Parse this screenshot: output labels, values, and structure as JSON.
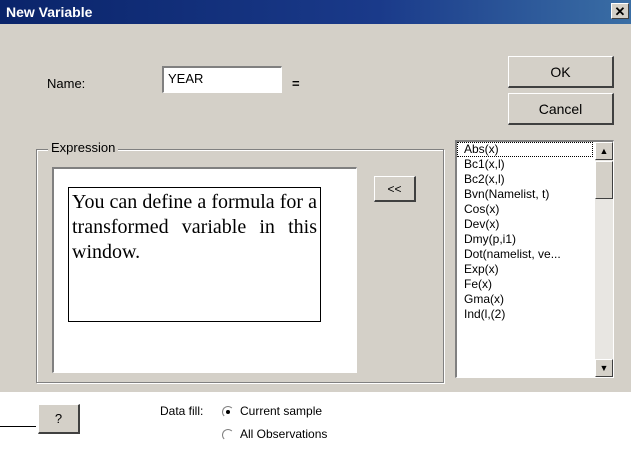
{
  "window": {
    "title": "New Variable",
    "close_glyph": "✕"
  },
  "name_field": {
    "label": "Name:",
    "value": "YEAR",
    "equals": "="
  },
  "buttons": {
    "ok": "OK",
    "cancel": "Cancel",
    "insert": "<<",
    "help": "?"
  },
  "expression": {
    "group_label": "Expression",
    "callout_text": "You can define a formula for a transformed variable in this window."
  },
  "functions": {
    "items": [
      "Abs(x)",
      "Bc1(x,l)",
      "Bc2(x,l)",
      "Bvn(Namelist, t)",
      "Cos(x)",
      "Dev(x)",
      "Dmy(p,i1)",
      "Dot(namelist, ve...",
      "Exp(x)",
      "Fe(x)",
      "Gma(x)",
      "Ind(l,(2)"
    ],
    "selected_index": 0
  },
  "data_fill": {
    "label": "Data fill:",
    "options": [
      "Current sample",
      "All Observations"
    ],
    "selected_index": 0
  },
  "icons": {
    "scroll_up": "▲",
    "scroll_down": "▼"
  },
  "colors": {
    "dialog_bg": "#d4d0c8",
    "titlebar": "#0a246a"
  }
}
